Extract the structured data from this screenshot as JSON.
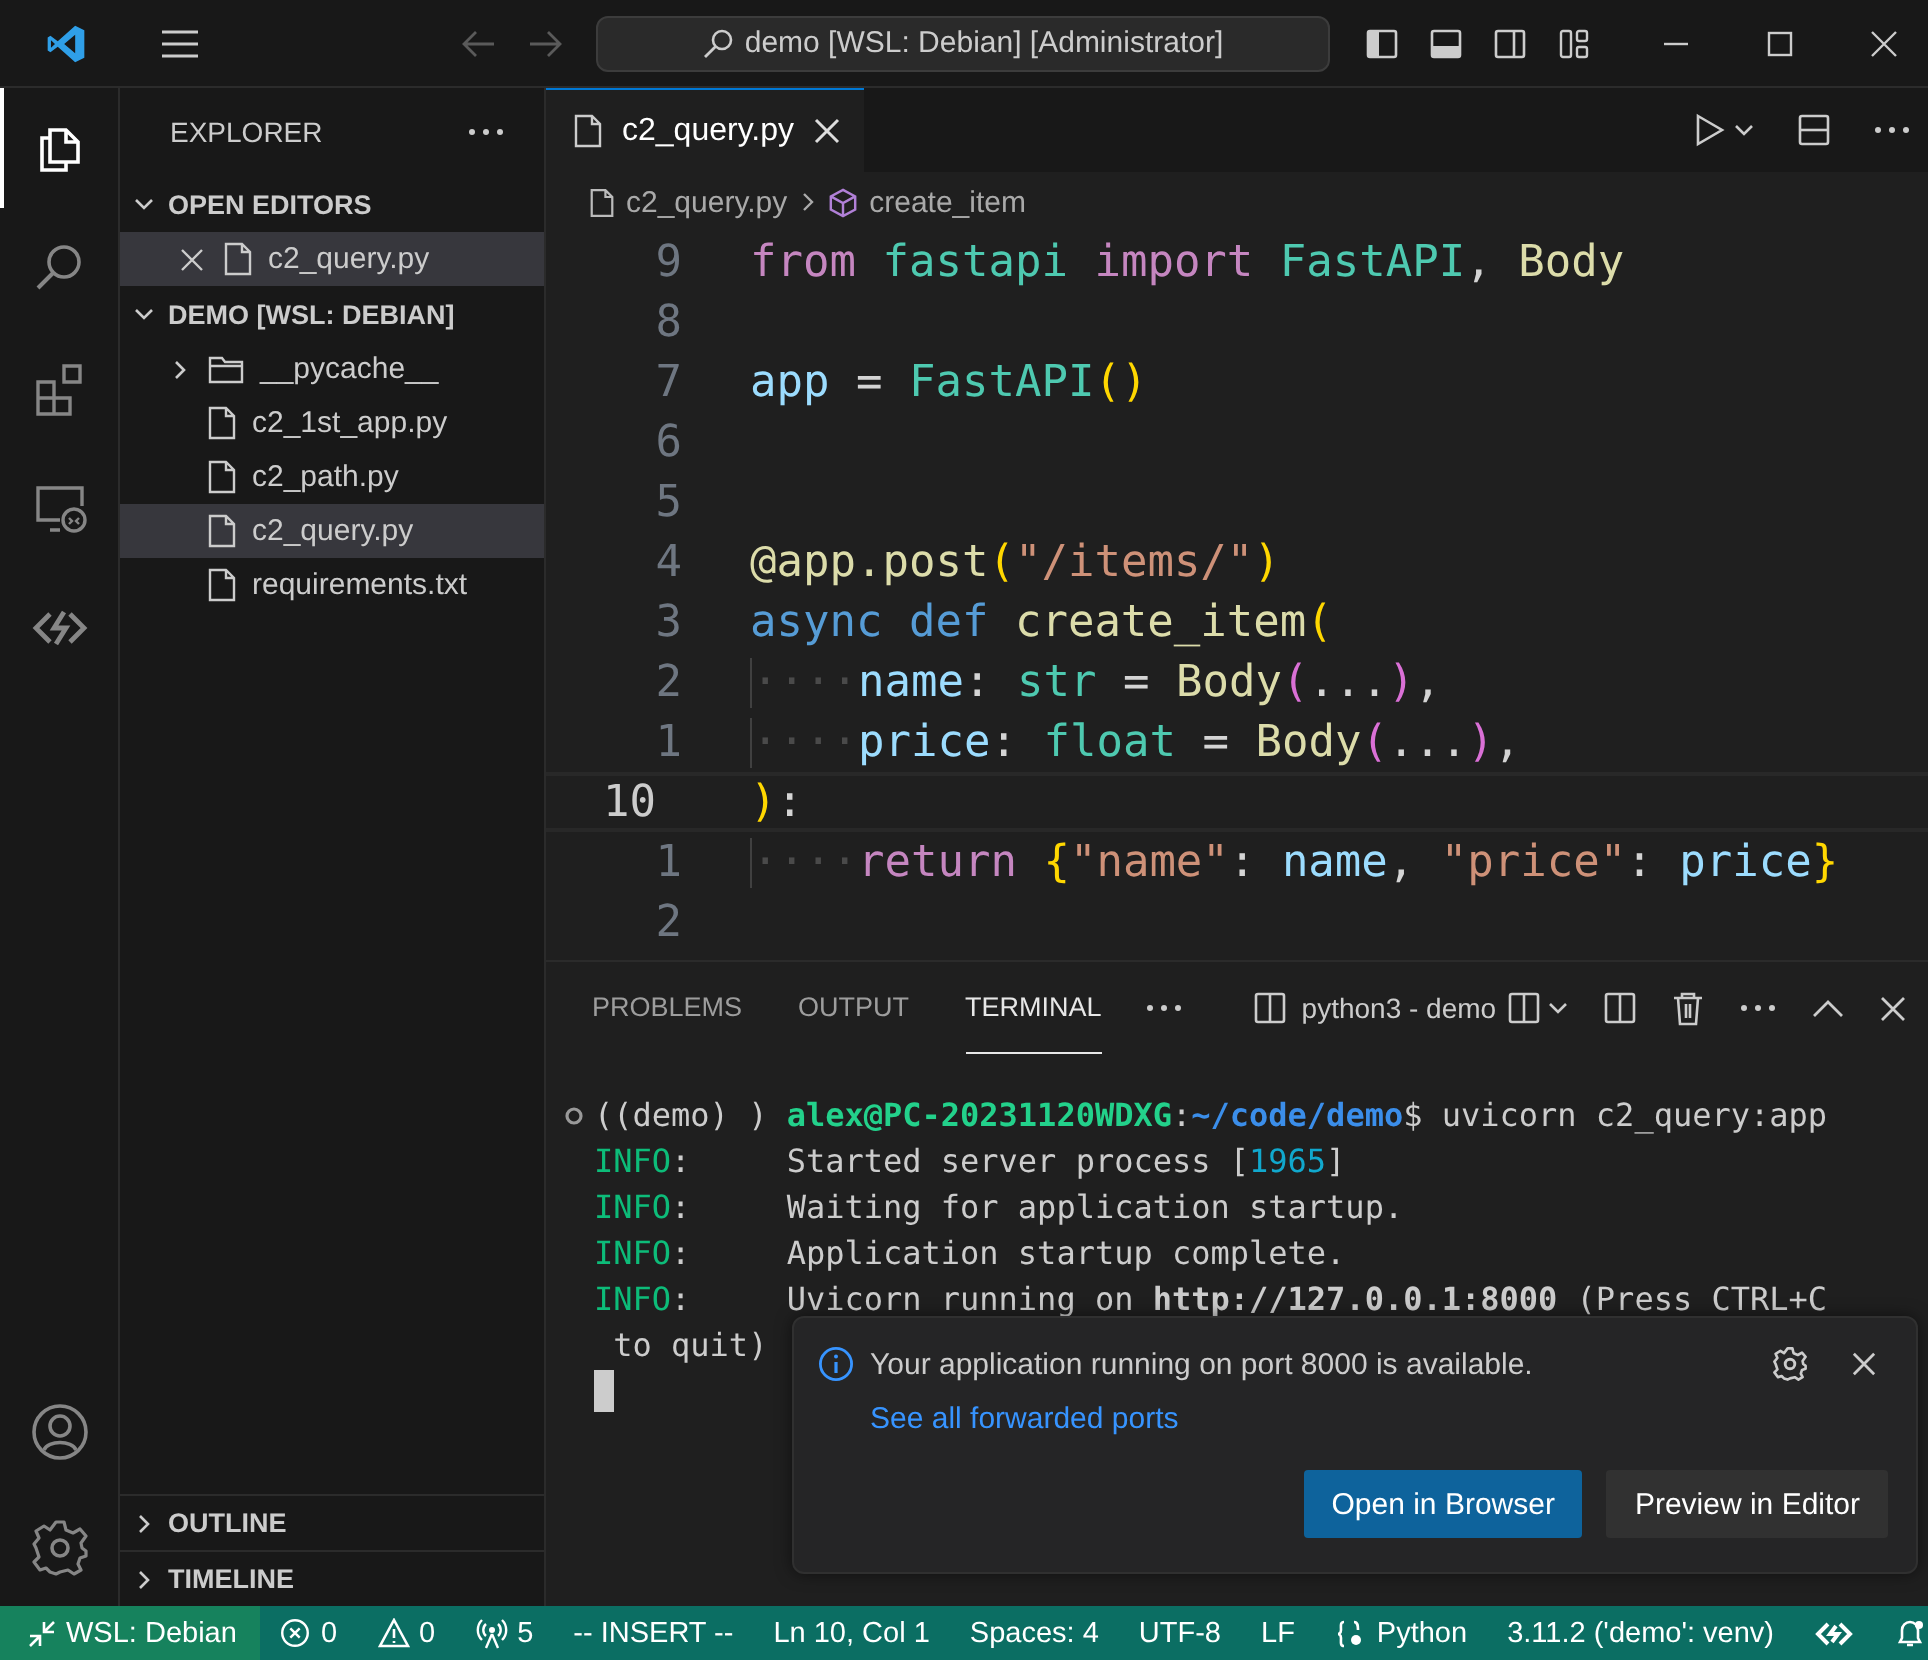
{
  "title_bar": {
    "search": "demo [WSL: Debian] [Administrator]"
  },
  "activity_bar": {
    "top": [
      {
        "kind": "explorer",
        "selected": true
      },
      {
        "kind": "search",
        "selected": false
      },
      {
        "kind": "extensions",
        "selected": false
      },
      {
        "kind": "remote",
        "selected": false
      },
      {
        "kind": "code",
        "selected": false
      }
    ],
    "bottom": [
      {
        "kind": "account"
      },
      {
        "kind": "settings"
      }
    ]
  },
  "sidebar": {
    "title": "EXPLORER",
    "sections": [
      {
        "title": "OPEN EDITORS",
        "expanded": true,
        "items": [
          {
            "name": "c2_query.py",
            "kind": "file",
            "closable": true,
            "selected": true
          }
        ]
      },
      {
        "title": "DEMO [WSL: DEBIAN]",
        "expanded": true,
        "items": [
          {
            "name": "__pycache__",
            "kind": "folder",
            "expanded": false,
            "selected": false
          },
          {
            "name": "c2_1st_app.py",
            "kind": "file",
            "selected": false
          },
          {
            "name": "c2_path.py",
            "kind": "file",
            "selected": false
          },
          {
            "name": "c2_query.py",
            "kind": "file",
            "selected": true
          },
          {
            "name": "requirements.txt",
            "kind": "file",
            "selected": false
          }
        ]
      }
    ],
    "bottom_sections": [
      {
        "title": "OUTLINE",
        "expanded": false
      },
      {
        "title": "TIMELINE",
        "expanded": false
      }
    ]
  },
  "editor": {
    "tabs": [
      {
        "label": "c2_query.py",
        "selected": true
      }
    ],
    "breadcrumb": [
      {
        "text": "c2_query.py",
        "kind": "file"
      },
      {
        "text": "create_item",
        "kind": "symbol"
      }
    ],
    "lines": [
      {
        "number": "9",
        "current": false,
        "tokens": [
          {
            "text": "from ",
            "kind": "kw"
          },
          {
            "text": "fastapi ",
            "kind": "type"
          },
          {
            "text": "import ",
            "kind": "kw"
          },
          {
            "text": "FastAPI",
            "kind": "type"
          },
          {
            "text": ", ",
            "kind": "plain"
          },
          {
            "text": "Body",
            "kind": "fn"
          }
        ]
      },
      {
        "number": "8",
        "current": false
      },
      {
        "number": "7",
        "current": false,
        "tokens": [
          {
            "text": "app ",
            "kind": "var"
          },
          {
            "text": "= ",
            "kind": "plain"
          },
          {
            "text": "FastAPI",
            "kind": "type"
          },
          {
            "text": "()",
            "kind": "b1"
          }
        ]
      },
      {
        "number": "6",
        "current": false
      },
      {
        "number": "5",
        "current": false
      },
      {
        "number": "4",
        "current": false,
        "tokens": [
          {
            "text": "@app.post",
            "kind": "fn"
          },
          {
            "text": "(",
            "kind": "b1"
          },
          {
            "text": "\"/items/\"",
            "kind": "str"
          },
          {
            "text": ")",
            "kind": "b1"
          }
        ]
      },
      {
        "number": "3",
        "current": false,
        "tokens": [
          {
            "text": "async def ",
            "kind": "storage"
          },
          {
            "text": "create_item",
            "kind": "fn"
          },
          {
            "text": "(",
            "kind": "b1"
          }
        ]
      },
      {
        "number": "2",
        "current": false,
        "tokens": [
          {
            "text": "····",
            "kind": "whitespace"
          },
          {
            "text": "name",
            "kind": "var"
          },
          {
            "text": ": ",
            "kind": "plain"
          },
          {
            "text": "str ",
            "kind": "type"
          },
          {
            "text": "= ",
            "kind": "plain"
          },
          {
            "text": "Body",
            "kind": "fn"
          },
          {
            "text": "(",
            "kind": "b2"
          },
          {
            "text": "...",
            "kind": "plain"
          },
          {
            "text": ")",
            "kind": "b2"
          },
          {
            "text": ",",
            "kind": "plain"
          }
        ]
      },
      {
        "number": "1",
        "current": false,
        "tokens": [
          {
            "text": "····",
            "kind": "whitespace"
          },
          {
            "text": "price",
            "kind": "var"
          },
          {
            "text": ": ",
            "kind": "plain"
          },
          {
            "text": "float ",
            "kind": "type"
          },
          {
            "text": "= ",
            "kind": "plain"
          },
          {
            "text": "Body",
            "kind": "fn"
          },
          {
            "text": "(",
            "kind": "b2"
          },
          {
            "text": "...",
            "kind": "plain"
          },
          {
            "text": ")",
            "kind": "b2"
          },
          {
            "text": ",",
            "kind": "plain"
          }
        ]
      },
      {
        "number": "10",
        "current": true,
        "tokens": [
          {
            "text": ")",
            "kind": "b1"
          },
          {
            "text": ":",
            "kind": "plain"
          }
        ]
      },
      {
        "number": "1",
        "current": false,
        "tokens": [
          {
            "text": "····",
            "kind": "whitespace"
          },
          {
            "text": "return ",
            "kind": "kw"
          },
          {
            "text": "{",
            "kind": "b1"
          },
          {
            "text": "\"name\"",
            "kind": "str"
          },
          {
            "text": ": ",
            "kind": "plain"
          },
          {
            "text": "name",
            "kind": "var"
          },
          {
            "text": ", ",
            "kind": "plain"
          },
          {
            "text": "\"price\"",
            "kind": "str"
          },
          {
            "text": ": ",
            "kind": "plain"
          },
          {
            "text": "price",
            "kind": "var"
          },
          {
            "text": "}",
            "kind": "b1"
          }
        ]
      },
      {
        "number": "2",
        "current": false
      }
    ]
  },
  "panel": {
    "tabs": [
      {
        "label": "PROBLEMS",
        "selected": false
      },
      {
        "label": "OUTPUT",
        "selected": false
      },
      {
        "label": "TERMINAL",
        "selected": true
      }
    ],
    "terminal_name": "python3 - demo",
    "terminal_lines": [
      {
        "tokens": [
          {
            "text": "((demo) ) ",
            "kind": "plain"
          },
          {
            "text": "alex@PC-20231120WDXG",
            "kind": "user"
          },
          {
            "text": ":",
            "kind": "plain"
          },
          {
            "text": "~/code/demo",
            "kind": "path"
          },
          {
            "text": "$ uvicorn c2_query:app",
            "kind": "plain"
          }
        ]
      },
      {
        "tokens": [
          {
            "text": "INFO",
            "kind": "info"
          },
          {
            "text": ":     Started server process [",
            "kind": "plain"
          },
          {
            "text": "1965",
            "kind": "num"
          },
          {
            "text": "]",
            "kind": "plain"
          }
        ]
      },
      {
        "tokens": [
          {
            "text": "INFO",
            "kind": "info"
          },
          {
            "text": ":     Waiting for application startup.",
            "kind": "plain"
          }
        ]
      },
      {
        "tokens": [
          {
            "text": "INFO",
            "kind": "info"
          },
          {
            "text": ":     Application startup complete.",
            "kind": "plain"
          }
        ]
      },
      {
        "tokens": [
          {
            "text": "INFO",
            "kind": "info"
          },
          {
            "text": ":     Uvicorn running on ",
            "kind": "plain"
          },
          {
            "text": "http://127.0.0.1:8000",
            "kind": "bold"
          },
          {
            "text": " (Press CTRL+C",
            "kind": "plain"
          }
        ]
      },
      {
        "tokens": [
          {
            "text": " to quit)",
            "kind": "plain"
          }
        ]
      }
    ]
  },
  "notification": {
    "message": "Your application running on port 8000 is available.",
    "link": "See all forwarded ports",
    "buttons": [
      {
        "label": "Open in Browser",
        "kind": "primary"
      },
      {
        "label": "Preview in Editor",
        "kind": "secondary"
      }
    ]
  },
  "status_bar": [
    {
      "kind": "remote",
      "text": "WSL: Debian"
    },
    {
      "kind": "errors",
      "text": "0"
    },
    {
      "kind": "warnings",
      "text": "0"
    },
    {
      "kind": "ports",
      "text": "5"
    },
    {
      "kind": "text",
      "text": "-- INSERT --"
    },
    {
      "kind": "text",
      "text": "Ln 10, Col 1"
    },
    {
      "kind": "text",
      "text": "Spaces: 4"
    },
    {
      "kind": "text",
      "text": "UTF-8"
    },
    {
      "kind": "text",
      "text": "LF"
    },
    {
      "kind": "language",
      "text": "Python"
    },
    {
      "kind": "text",
      "text": "3.11.2 ('demo': venv)"
    },
    {
      "kind": "copilot"
    },
    {
      "kind": "bell"
    }
  ]
}
